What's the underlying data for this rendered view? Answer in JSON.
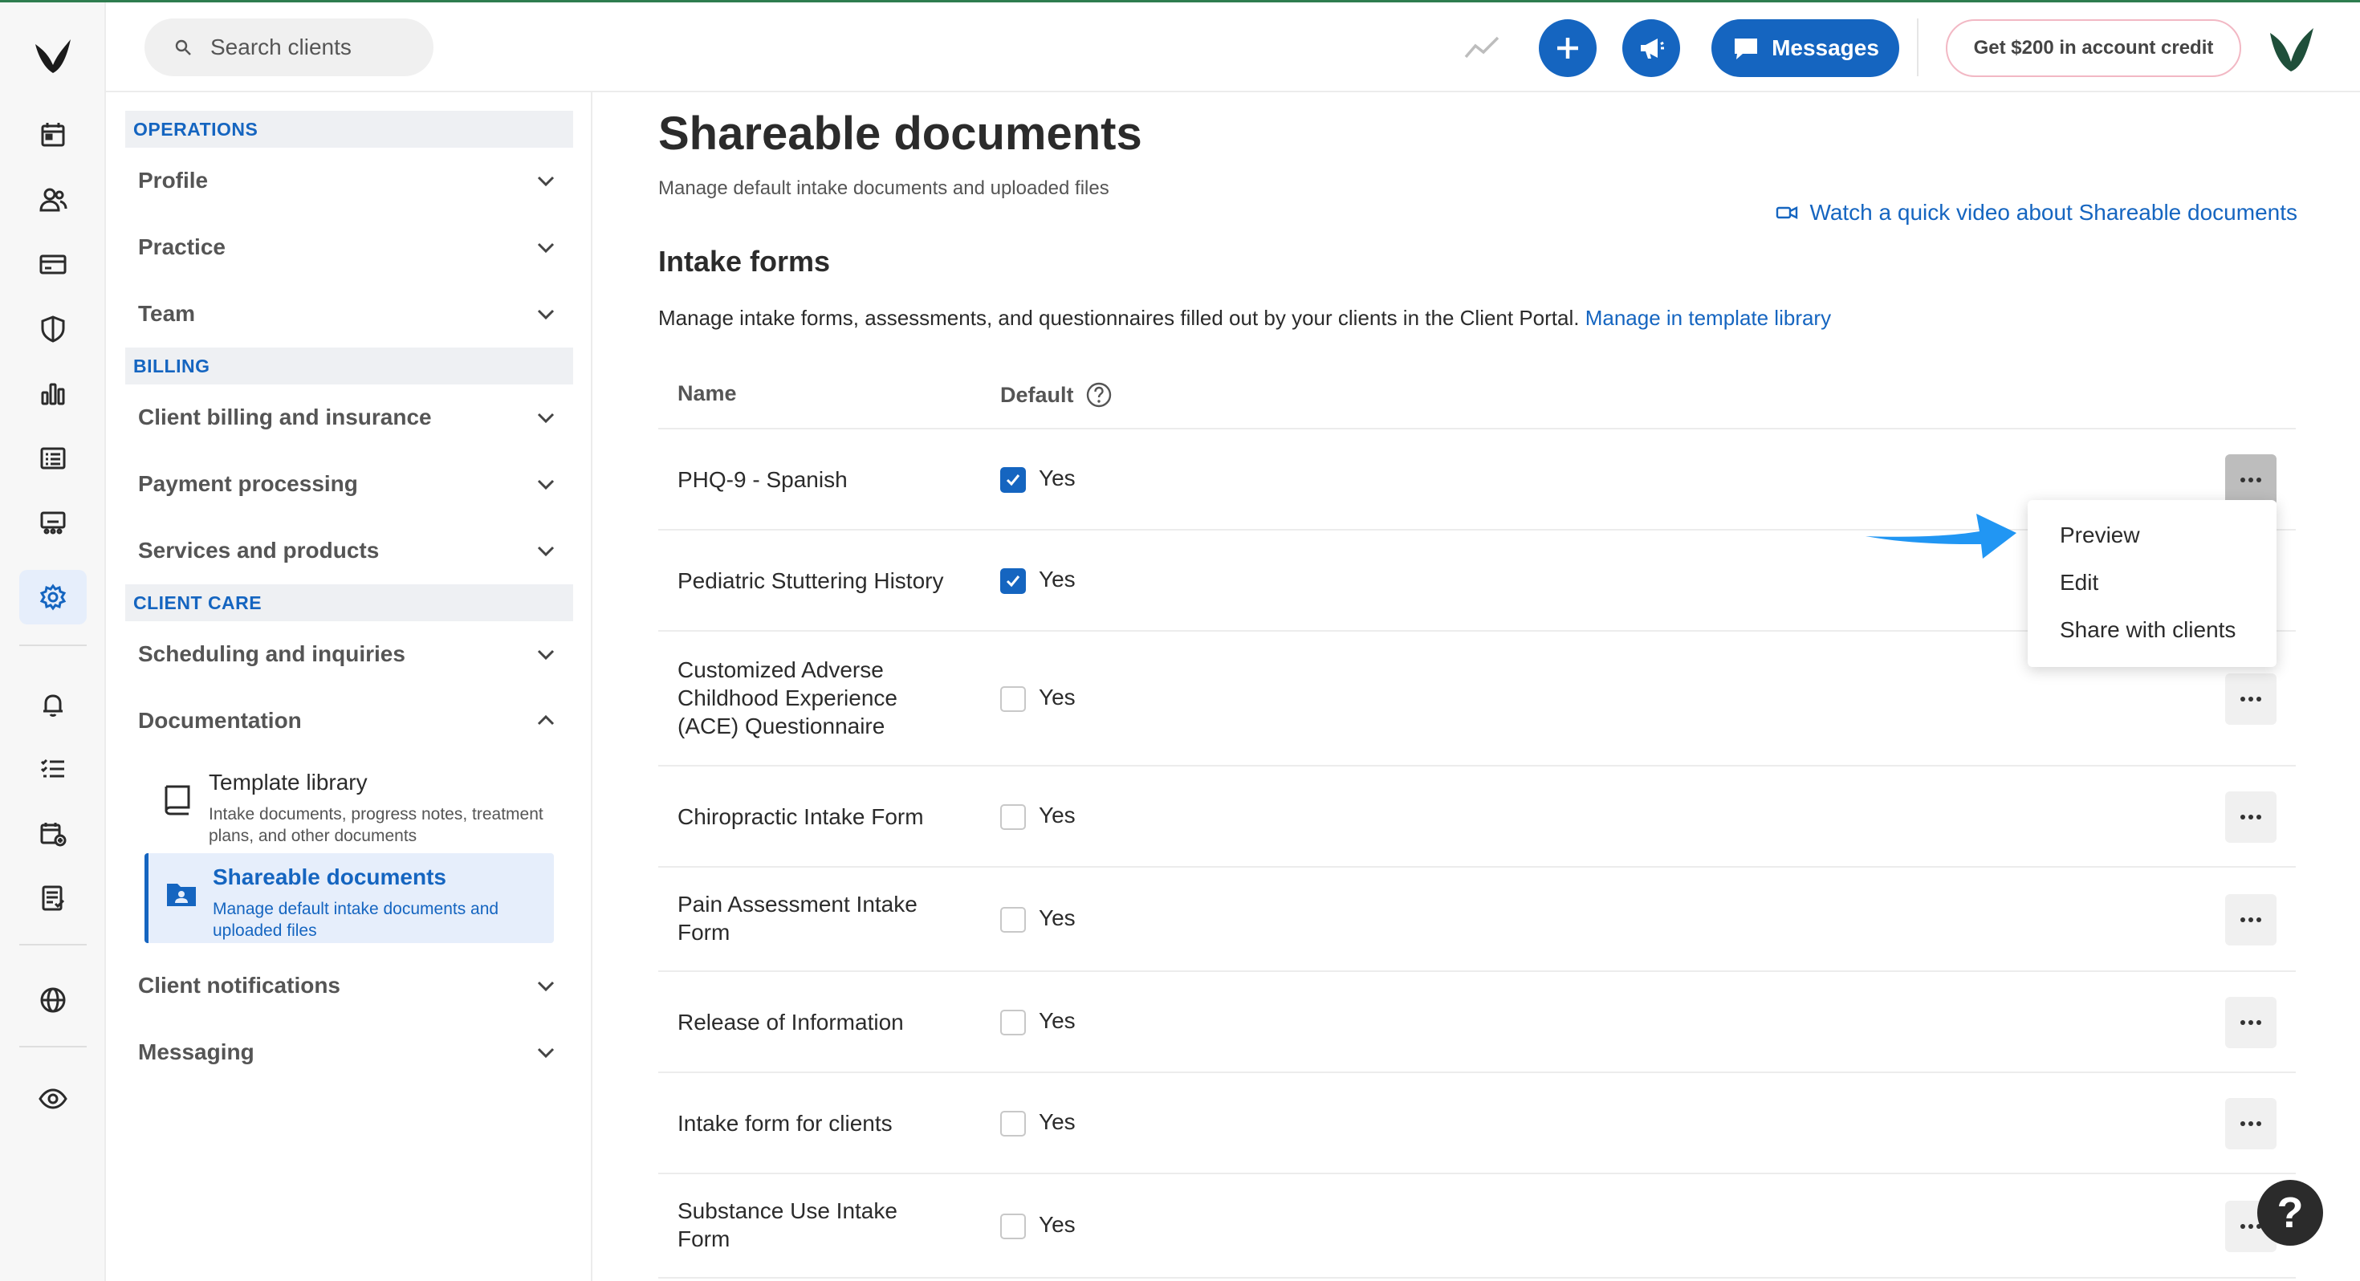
{
  "search": {
    "placeholder": "Search clients"
  },
  "topbar": {
    "messages_label": "Messages",
    "credit_label": "Get $200 in account credit"
  },
  "colors": {
    "accent": "#1565c0",
    "brand_green": "#1f4f3a",
    "arrow": "#2196f3"
  },
  "rail_icons": [
    "calendar-icon",
    "clients-icon",
    "billing-icon",
    "insurance-shield-icon",
    "analytics-icon",
    "reports-icon",
    "marketplace-icon",
    "settings-gear-icon",
    "notifications-bell-icon",
    "tasks-icon",
    "calendar-add-icon",
    "documentation-icon",
    "globe-icon",
    "privacy-eye-icon"
  ],
  "settings": {
    "operations_title": "OPERATIONS",
    "billing_title": "BILLING",
    "client_care_title": "CLIENT CARE",
    "profile": "Profile",
    "practice": "Practice",
    "team": "Team",
    "client_billing": "Client billing and insurance",
    "payment_processing": "Payment processing",
    "services_products": "Services and products",
    "scheduling": "Scheduling and inquiries",
    "documentation": "Documentation",
    "template_library": {
      "title": "Template library",
      "desc": "Intake documents, progress notes, treatment plans, and other documents"
    },
    "shareable_documents": {
      "title": "Shareable documents",
      "desc": "Manage default intake documents and uploaded files"
    },
    "client_notifications": "Client notifications",
    "messaging": "Messaging"
  },
  "main": {
    "title": "Shareable documents",
    "subtitle": "Manage default intake documents and uploaded files",
    "video_link": "Watch a quick video about Shareable documents",
    "section_title": "Intake forms",
    "section_desc": "Manage intake forms, assessments, and questionnaires filled out by your clients in the Client Portal.",
    "section_link": "Manage in template library",
    "col_name": "Name",
    "col_default": "Default",
    "yes_label": "Yes",
    "rows": [
      {
        "name": "PHQ-9 - Spanish",
        "default": true
      },
      {
        "name": "Pediatric Stuttering History",
        "default": true
      },
      {
        "name": "Customized Adverse Childhood Experience (ACE) Questionnaire",
        "default": false
      },
      {
        "name": "Chiropractic Intake Form",
        "default": false
      },
      {
        "name": "Pain Assessment Intake Form",
        "default": false
      },
      {
        "name": "Release of Information",
        "default": false
      },
      {
        "name": "Intake form for clients",
        "default": false
      },
      {
        "name": "Substance Use Intake Form",
        "default": false
      }
    ]
  },
  "dropdown": {
    "preview": "Preview",
    "edit": "Edit",
    "share": "Share with clients"
  },
  "help": {
    "label": "?"
  }
}
